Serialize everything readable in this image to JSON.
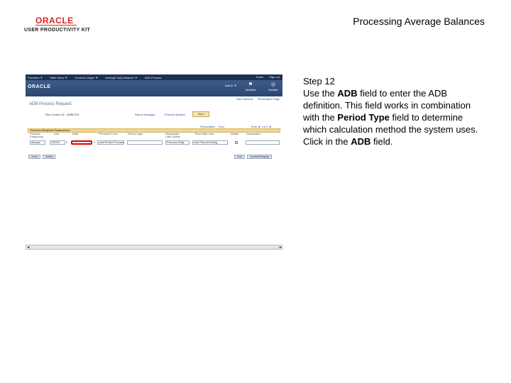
{
  "brand": {
    "oracle": "ORACLE",
    "upk": "USER PRODUCTIVITY KIT"
  },
  "page_title": "Processing Average Balances",
  "screenshot": {
    "topnav": {
      "items": [
        "Favorites ▼",
        "Main Menu ▼",
        "General Ledger ▼",
        "Average Daily Balance ▼",
        "ADB Process"
      ],
      "right": [
        "Home",
        "Sign out"
      ]
    },
    "banner": {
      "oracle": "ORACLE",
      "actions": "Add to ▼",
      "worklist": "Worklist",
      "navbar": "NavBar"
    },
    "links": [
      "New Window",
      "Personalize Page"
    ],
    "component_title": "ADB Process Request",
    "run_control_label": "Run Control ID:",
    "run_control_value": "ADBUT01",
    "report_manager": "Report Manager",
    "process_monitor": "Process Monitor",
    "run_button": "Run",
    "grid": {
      "tools": [
        "Personalize",
        "Find"
      ],
      "pager": "First ◄ 1 of 1 ►",
      "title": "Process Request Parameters",
      "columns": [
        "Process Frequency",
        "Unit",
        "ADB",
        "*Process From",
        "Period Type",
        "Requested Calc Option",
        "*Run Date Calc",
        "Within",
        "Description"
      ],
      "row": {
        "frequency": "Always",
        "unit": "US001",
        "adb": "",
        "process_from": "Last Period Processed",
        "period_type": "",
        "calc_option": "Process Daily",
        "run_date_calc": "Use Period Ending"
      }
    },
    "buttons_left": [
      "Save",
      "Notify"
    ],
    "buttons_right": [
      "Add",
      "Update/Display"
    ],
    "scroll": {
      "left": "◄",
      "right": "►"
    }
  },
  "instructions": {
    "step": "Step 12",
    "p1_pre": "Use the ",
    "p1_kw1": "ADB",
    "p1_mid": " field to enter the ADB definition. This field works in combination with the ",
    "p1_kw2": "Period Type",
    "p1_post": " field to determine which calculation method the system uses.",
    "p2_pre": "Click in the ",
    "p2_kw": "ADB",
    "p2_post": " field."
  }
}
